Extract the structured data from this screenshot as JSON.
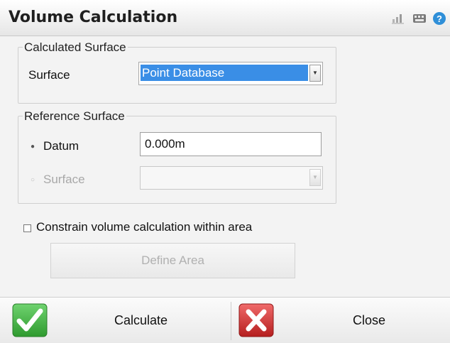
{
  "window": {
    "title": "Volume Calculation",
    "icons": [
      "bar-chart-icon",
      "keyboard-icon",
      "help-icon"
    ]
  },
  "calculated_surface": {
    "legend": "Calculated Surface",
    "surface_label": "Surface",
    "surface_value": "Point Database"
  },
  "reference_surface": {
    "legend": "Reference Surface",
    "datum_label": "Datum",
    "datum_selected": true,
    "datum_value": "0.000m",
    "surface_label": "Surface",
    "surface_value": ""
  },
  "constrain": {
    "label": "Constrain volume calculation within area",
    "checked": false,
    "define_area_label": "Define Area"
  },
  "footer": {
    "calculate_label": "Calculate",
    "close_label": "Close"
  },
  "colors": {
    "selection": "#3a8ee6",
    "calculate_icon": "#3aa53a",
    "close_icon": "#d42a2a"
  }
}
